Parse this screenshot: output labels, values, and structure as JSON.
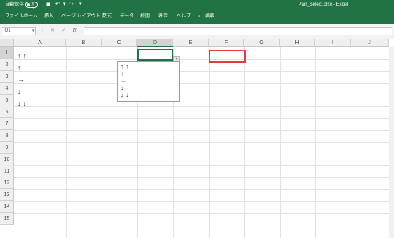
{
  "titlebar": {
    "autosave_label": "自動保存",
    "autosave_state": "オフ",
    "window_title": "Pair_Select.xlsx  -  Excel"
  },
  "ribbon": {
    "tabs": [
      "ファイル",
      "ホーム",
      "挿入",
      "ページ レイアウト",
      "数式",
      "データ",
      "校閲",
      "表示",
      "ヘルプ"
    ],
    "search_label": "検索"
  },
  "formula_bar": {
    "name_box": "D1",
    "fx_label": "fx",
    "formula": ""
  },
  "grid": {
    "columns": [
      "A",
      "B",
      "C",
      "D",
      "E",
      "F",
      "G",
      "H",
      "I",
      "J"
    ],
    "selected_column": "D",
    "rows": [
      "1",
      "2",
      "3",
      "4",
      "5",
      "6",
      "7",
      "8",
      "9",
      "10",
      "11",
      "12",
      "13",
      "14",
      "15"
    ],
    "selected_row": "1",
    "cells": {
      "A1": "↑ ↑",
      "A2": "↑",
      "A3": "→",
      "A4": "↓",
      "A5": "↓ ↓"
    }
  },
  "dropdown": {
    "items": [
      "↑ ↑",
      "↑",
      "→",
      "↓",
      "↓ ↓"
    ]
  },
  "colors": {
    "accent": "#217346",
    "highlight": "#e53b3b"
  }
}
